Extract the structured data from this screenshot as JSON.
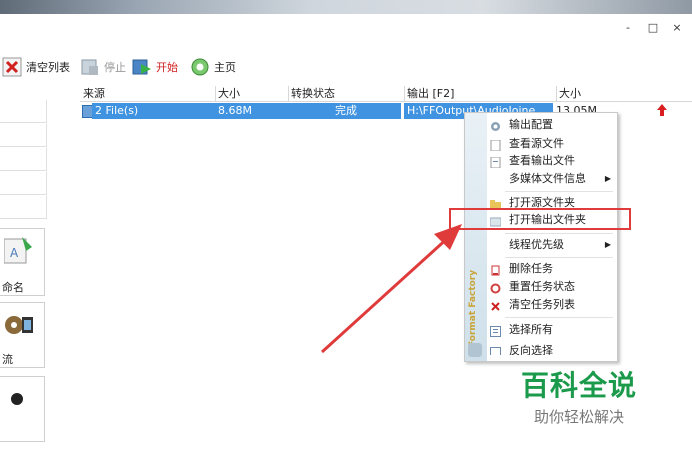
{
  "window": {
    "minimize": "-",
    "maximize": "□",
    "close": "×"
  },
  "toolbar": {
    "clear_list": "清空列表",
    "stop": "停止",
    "start": "开始",
    "home": "主页"
  },
  "table": {
    "headers": [
      "来源",
      "大小",
      "转换状态",
      "输出 [F2]",
      "大小"
    ],
    "rows": [
      {
        "source": "2 File(s)",
        "size": "8.68M",
        "status": "完成",
        "output": "H:\\FFOutput\\AudioJoine",
        "out_size": "13.05M"
      }
    ]
  },
  "left_panel": {
    "rename_label": "命名",
    "video_label": "流"
  },
  "context_menu": {
    "strip_text": "Format Factory",
    "items": [
      {
        "label": "输出配置",
        "icon": "gear-icon"
      },
      {
        "label": "查看源文件",
        "icon": "document-icon"
      },
      {
        "label": "查看输出文件",
        "icon": "document-icon"
      },
      {
        "label": "多媒体文件信息",
        "icon": "",
        "submenu": true
      },
      {
        "label": "打开源文件夹",
        "icon": "folder-icon"
      },
      {
        "label": "打开输出文件夹",
        "icon": "folder-icon"
      },
      {
        "label": "线程优先级",
        "icon": "",
        "submenu": true
      },
      {
        "label": "删除任务",
        "icon": "delete-icon"
      },
      {
        "label": "重置任务状态",
        "icon": "reset-icon"
      },
      {
        "label": "清空任务列表",
        "icon": "clear-icon"
      },
      {
        "label": "选择所有",
        "icon": "select-all-icon"
      },
      {
        "label": "反向选择",
        "icon": "invert-icon"
      }
    ]
  },
  "watermark": {
    "title": "百科全说",
    "subtitle": "助你轻松解决"
  },
  "colors": {
    "selection": "#3f93e0",
    "highlight_box": "#e03b3b",
    "watermark_green": "#1a9a4a",
    "arrow": "#e03b3b"
  }
}
